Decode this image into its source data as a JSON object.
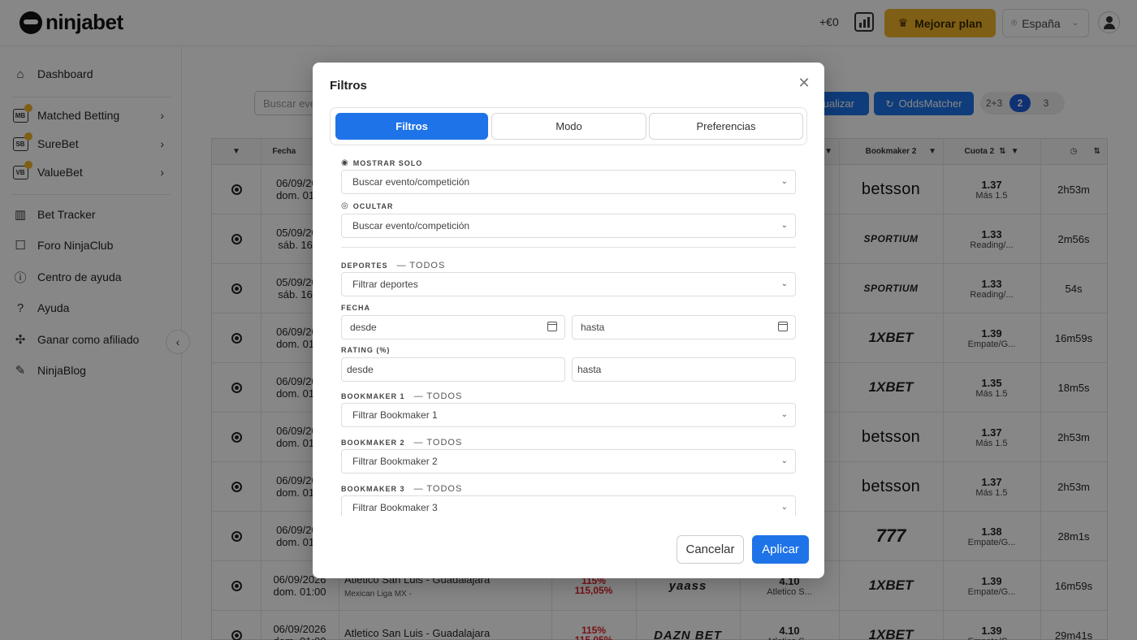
{
  "header": {
    "logo_text": "ninjabet",
    "balance": "+€0",
    "upgrade_label": "Mejorar plan",
    "country": "España"
  },
  "sidebar": {
    "items": [
      {
        "label": "Dashboard",
        "icon": "home-icon"
      },
      {
        "label": "Matched Betting",
        "icon": "mb-badge-icon",
        "badge": "MB"
      },
      {
        "label": "SureBet",
        "icon": "sb-badge-icon",
        "badge": "SB"
      },
      {
        "label": "ValueBet",
        "icon": "vb-badge-icon",
        "badge": "VB"
      },
      {
        "label": "Bet Tracker",
        "icon": "chart-icon"
      },
      {
        "label": "Foro NinjaClub",
        "icon": "chat-icon"
      },
      {
        "label": "Centro de ayuda",
        "icon": "help-icon"
      },
      {
        "label": "Ayuda",
        "icon": "question-icon"
      },
      {
        "label": "Ganar como afiliado",
        "icon": "affiliate-icon"
      },
      {
        "label": "NinjaBlog",
        "icon": "pen-icon"
      }
    ]
  },
  "toolbar": {
    "search_placeholder": "Buscar eve",
    "refresh_label": "tualizar",
    "oddsmatcher_label": "OddsMatcher",
    "pages": [
      "2+3",
      "2",
      "3"
    ]
  },
  "table": {
    "headers": {
      "fecha": "Fecha",
      "bookmaker2": "Bookmaker 2",
      "cuota2": "Cuota 2"
    },
    "rows": [
      {
        "date": "06/09/202",
        "time": "dom. 01:0",
        "bm2": "betsson",
        "q": "1.37",
        "qs": "Más 1.5",
        "t": "2h53m"
      },
      {
        "date": "05/09/202",
        "time": "sáb. 16:0",
        "bm2": "SPORTIUM",
        "q": "1.33",
        "qs": "Reading/...",
        "t": "2m56s"
      },
      {
        "date": "05/09/202",
        "time": "sáb. 16:0",
        "bm2": "SPORTIUM",
        "q": "1.33",
        "qs": "Reading/...",
        "t": "54s"
      },
      {
        "date": "06/09/202",
        "time": "dom. 01:0",
        "bm2": "1XBET",
        "q": "1.39",
        "qs": "Empate/G...",
        "t": "16m59s"
      },
      {
        "date": "06/09/202",
        "time": "dom. 01:0",
        "bm2": "1XBET",
        "q": "1.35",
        "qs": "Más 1.5",
        "t": "18m5s"
      },
      {
        "date": "06/09/202",
        "time": "dom. 01:0",
        "bm2": "betsson",
        "q": "1.37",
        "qs": "Más 1.5",
        "t": "2h53m"
      },
      {
        "date": "06/09/202",
        "time": "dom. 01:0",
        "bm2": "betsson",
        "q": "1.37",
        "qs": "Más 1.5",
        "t": "2h53m"
      },
      {
        "date": "06/09/202",
        "time": "dom. 01:0",
        "bm2": "777",
        "q": "1.38",
        "qs": "Empate/G...",
        "t": "28m1s"
      },
      {
        "date": "06/09/2026",
        "time": "dom. 01:00",
        "event": "Atletico San Luis - Guadalajara",
        "league": "Mexican Liga MX -",
        "rating1": "115%",
        "rating2": "115,05%",
        "bm1": "yaass",
        "q1": "4.10",
        "q1s": "Atletico S...",
        "bm2": "1XBET",
        "q": "1.39",
        "qs": "Empate/G...",
        "t": "16m59s"
      },
      {
        "date": "06/09/2026",
        "time": "dom. 01:00",
        "event": "Atletico San Luis - Guadalajara",
        "league": "",
        "rating1": "115%",
        "rating2": "115,05%",
        "bm1": "DAZN BET",
        "q1": "4.10",
        "q1s": "Atletico S...",
        "bm2": "1XBET",
        "q": "1.39",
        "qs": "Empate/G...",
        "t": "29m41s"
      }
    ]
  },
  "modal": {
    "title": "Filtros",
    "tabs": [
      "Filtros",
      "Modo",
      "Preferencias"
    ],
    "mostrar_solo": {
      "label": "MOSTRAR SOLO",
      "placeholder": "Buscar evento/competición"
    },
    "ocultar": {
      "label": "OCULTAR",
      "placeholder": "Buscar evento/competición"
    },
    "deportes": {
      "label": "DEPORTES",
      "all": "— TODOS",
      "placeholder": "Filtrar deportes"
    },
    "fecha": {
      "label": "FECHA",
      "from": "desde",
      "to": "hasta"
    },
    "rating": {
      "label": "RATING (%)",
      "from": "desde",
      "to": "hasta"
    },
    "bookmaker1": {
      "label": "BOOKMAKER 1",
      "all": "— TODOS",
      "placeholder": "Filtrar Bookmaker 1"
    },
    "bookmaker2": {
      "label": "BOOKMAKER 2",
      "all": "— TODOS",
      "placeholder": "Filtrar Bookmaker 2"
    },
    "bookmaker3": {
      "label": "BOOKMAKER 3",
      "all": "— TODOS",
      "placeholder": "Filtrar Bookmaker 3"
    },
    "cancel": "Cancelar",
    "apply": "Aplicar"
  }
}
